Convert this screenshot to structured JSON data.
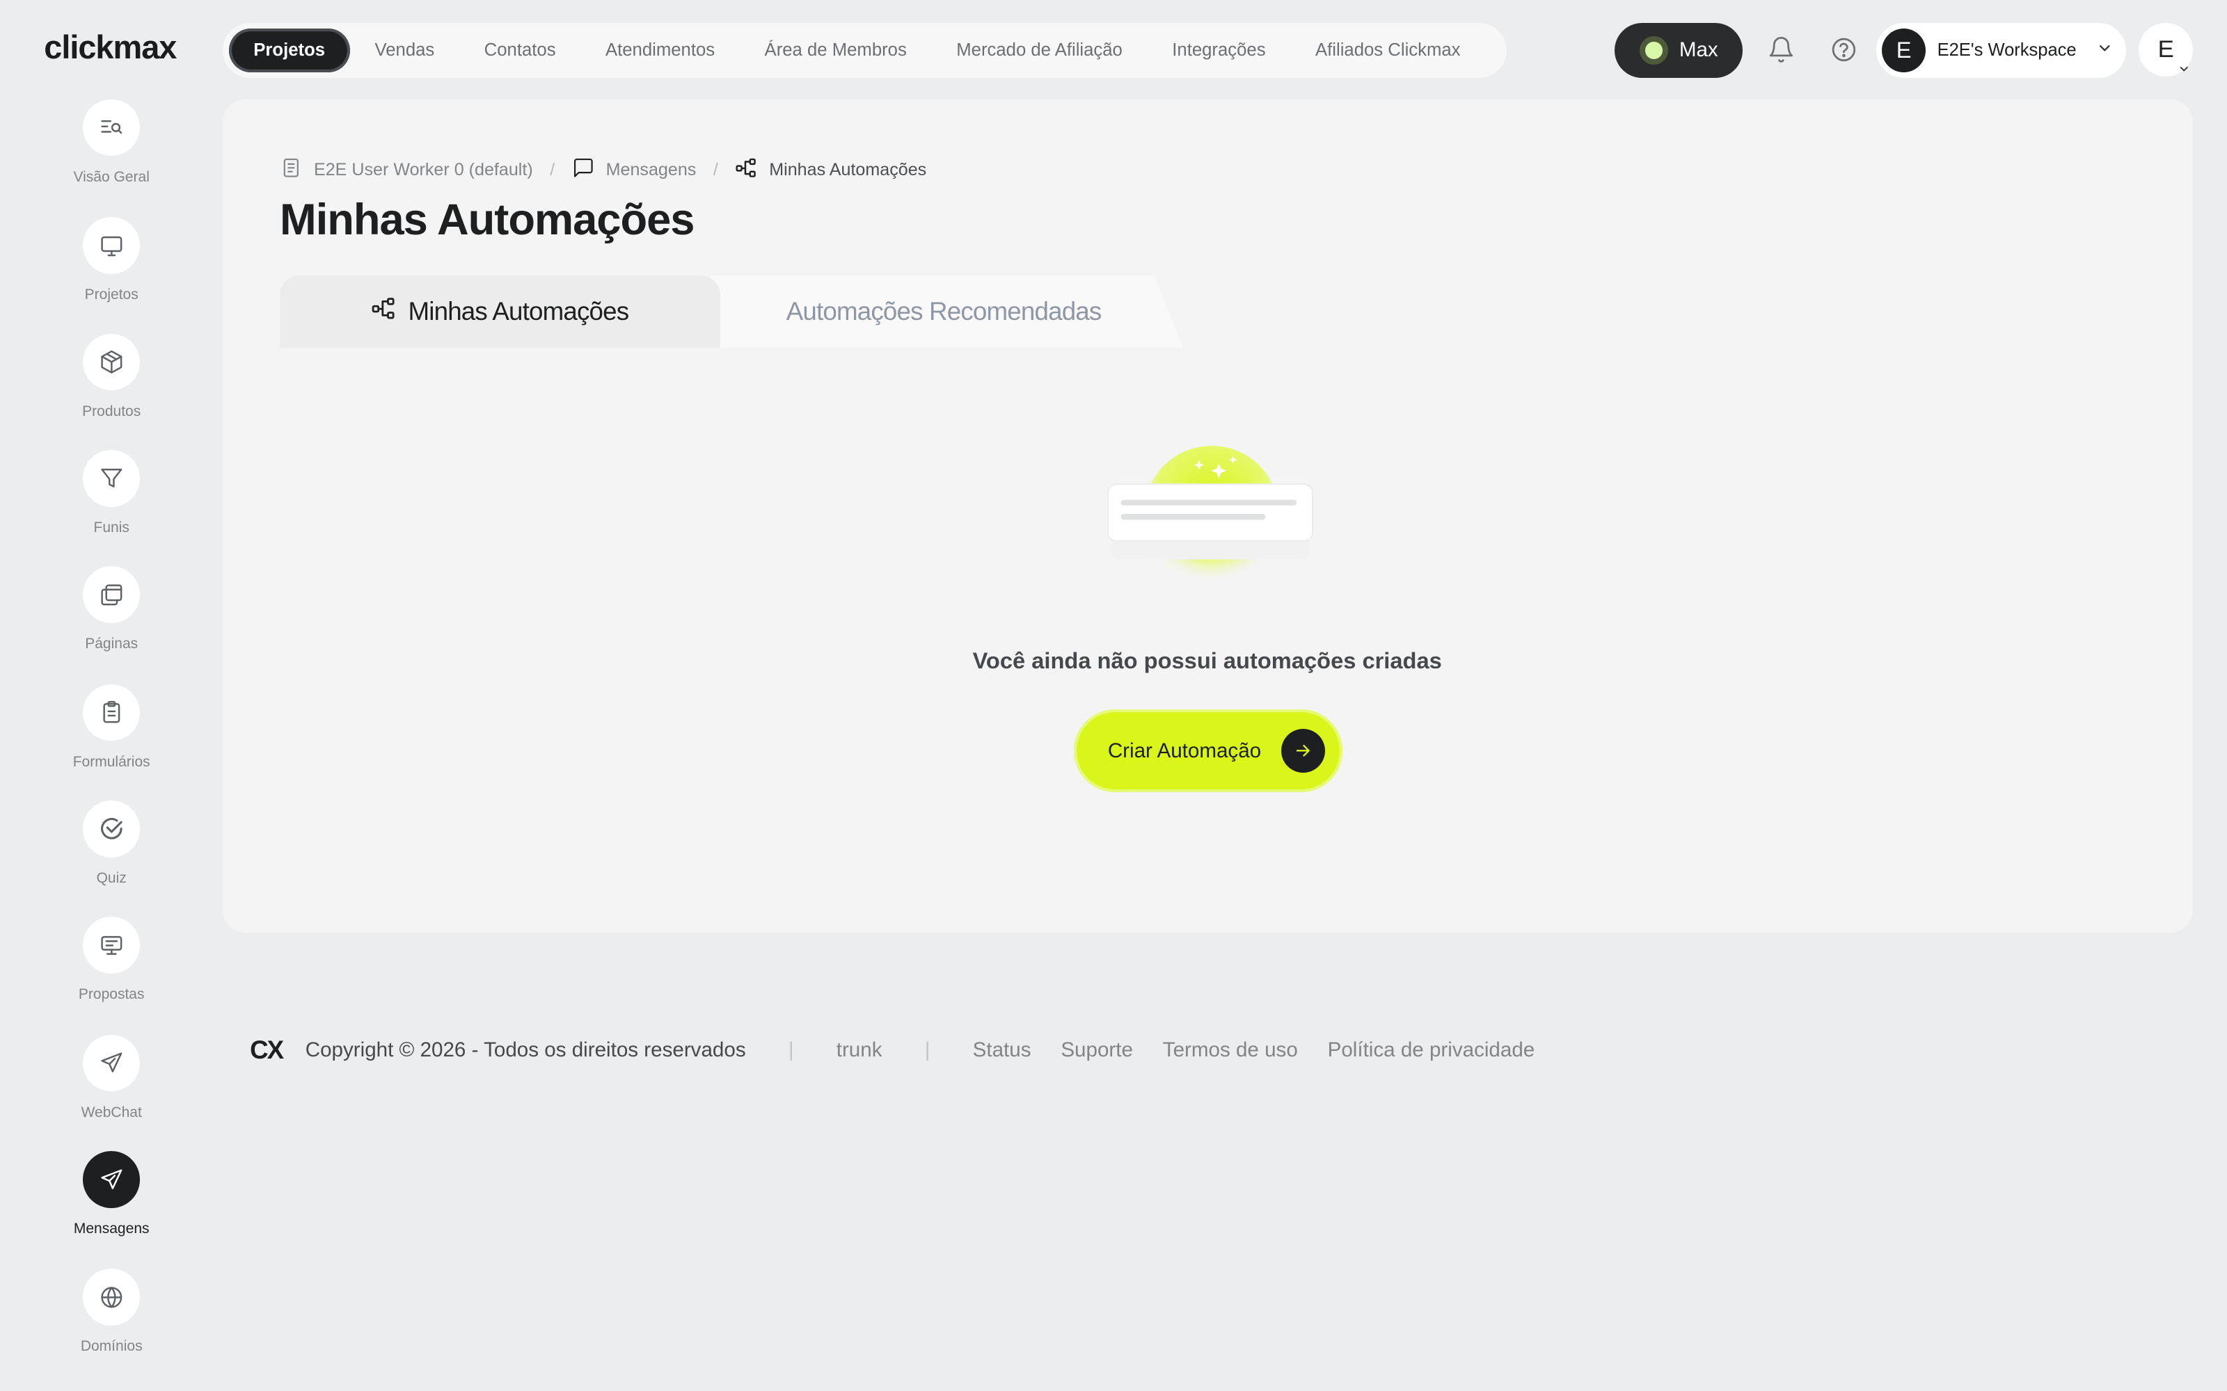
{
  "app": {
    "logo": "clickmax"
  },
  "topnav": {
    "items": [
      "Projetos",
      "Vendas",
      "Contatos",
      "Atendimentos",
      "Área de Membros",
      "Mercado de Afiliação",
      "Integrações",
      "Afiliados Clickmax"
    ],
    "active": "Projetos"
  },
  "header": {
    "max_label": "Max",
    "workspace_initial": "E",
    "workspace_label": "E2E's Workspace",
    "user_initial": "E"
  },
  "sidebar": {
    "items": [
      {
        "label": "Visão Geral",
        "icon": "overview-search-icon"
      },
      {
        "label": "Projetos",
        "icon": "monitor-icon"
      },
      {
        "label": "Produtos",
        "icon": "box-icon"
      },
      {
        "label": "Funis",
        "icon": "funnel-icon"
      },
      {
        "label": "Páginas",
        "icon": "pages-icon"
      },
      {
        "label": "Formulários",
        "icon": "clipboard-icon"
      },
      {
        "label": "Quiz",
        "icon": "check-circle-icon"
      },
      {
        "label": "Propostas",
        "icon": "presentation-icon"
      },
      {
        "label": "WebChat",
        "icon": "send-icon"
      },
      {
        "label": "Mensagens",
        "icon": "send-icon"
      },
      {
        "label": "Domínios",
        "icon": "globe-icon"
      }
    ],
    "active": "Mensagens"
  },
  "breadcrumb": {
    "items": [
      "E2E User Worker 0 (default)",
      "Mensagens",
      "Minhas Automações"
    ]
  },
  "page": {
    "title": "Minhas Automações",
    "tabs": [
      "Minhas Automações",
      "Automações Recomendadas"
    ],
    "active_tab": "Minhas Automações",
    "empty_text": "Você ainda não possui automações criadas",
    "create_button": "Criar Automação"
  },
  "footer": {
    "mark": "CX",
    "copyright": "Copyright © 2026 - Todos os direitos reservados",
    "branch": "trunk",
    "links": [
      "Status",
      "Suporte",
      "Termos de uso",
      "Política de privacidade"
    ]
  },
  "colors": {
    "accent": "#d9f51a",
    "dark": "#1d1f21",
    "background": "#ebedee"
  }
}
